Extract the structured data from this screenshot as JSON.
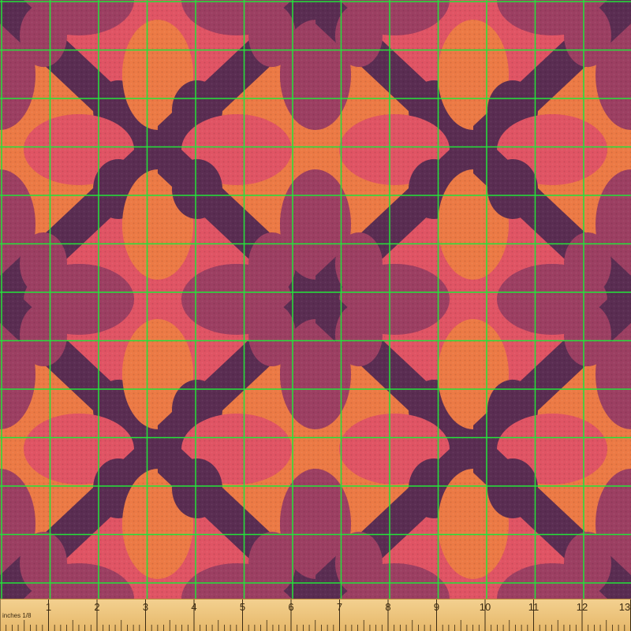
{
  "ruler": {
    "unit_label": "inches 1/8",
    "numbers": [
      "1",
      "2",
      "3",
      "4",
      "5",
      "6",
      "7",
      "8",
      "9",
      "10",
      "11",
      "12",
      "13"
    ]
  },
  "colors": {
    "plum": "#5a2d52",
    "mauve": "#9c3f62",
    "pink": "#e05464",
    "orange": "#ec7a45",
    "grid": "#22e33a"
  }
}
